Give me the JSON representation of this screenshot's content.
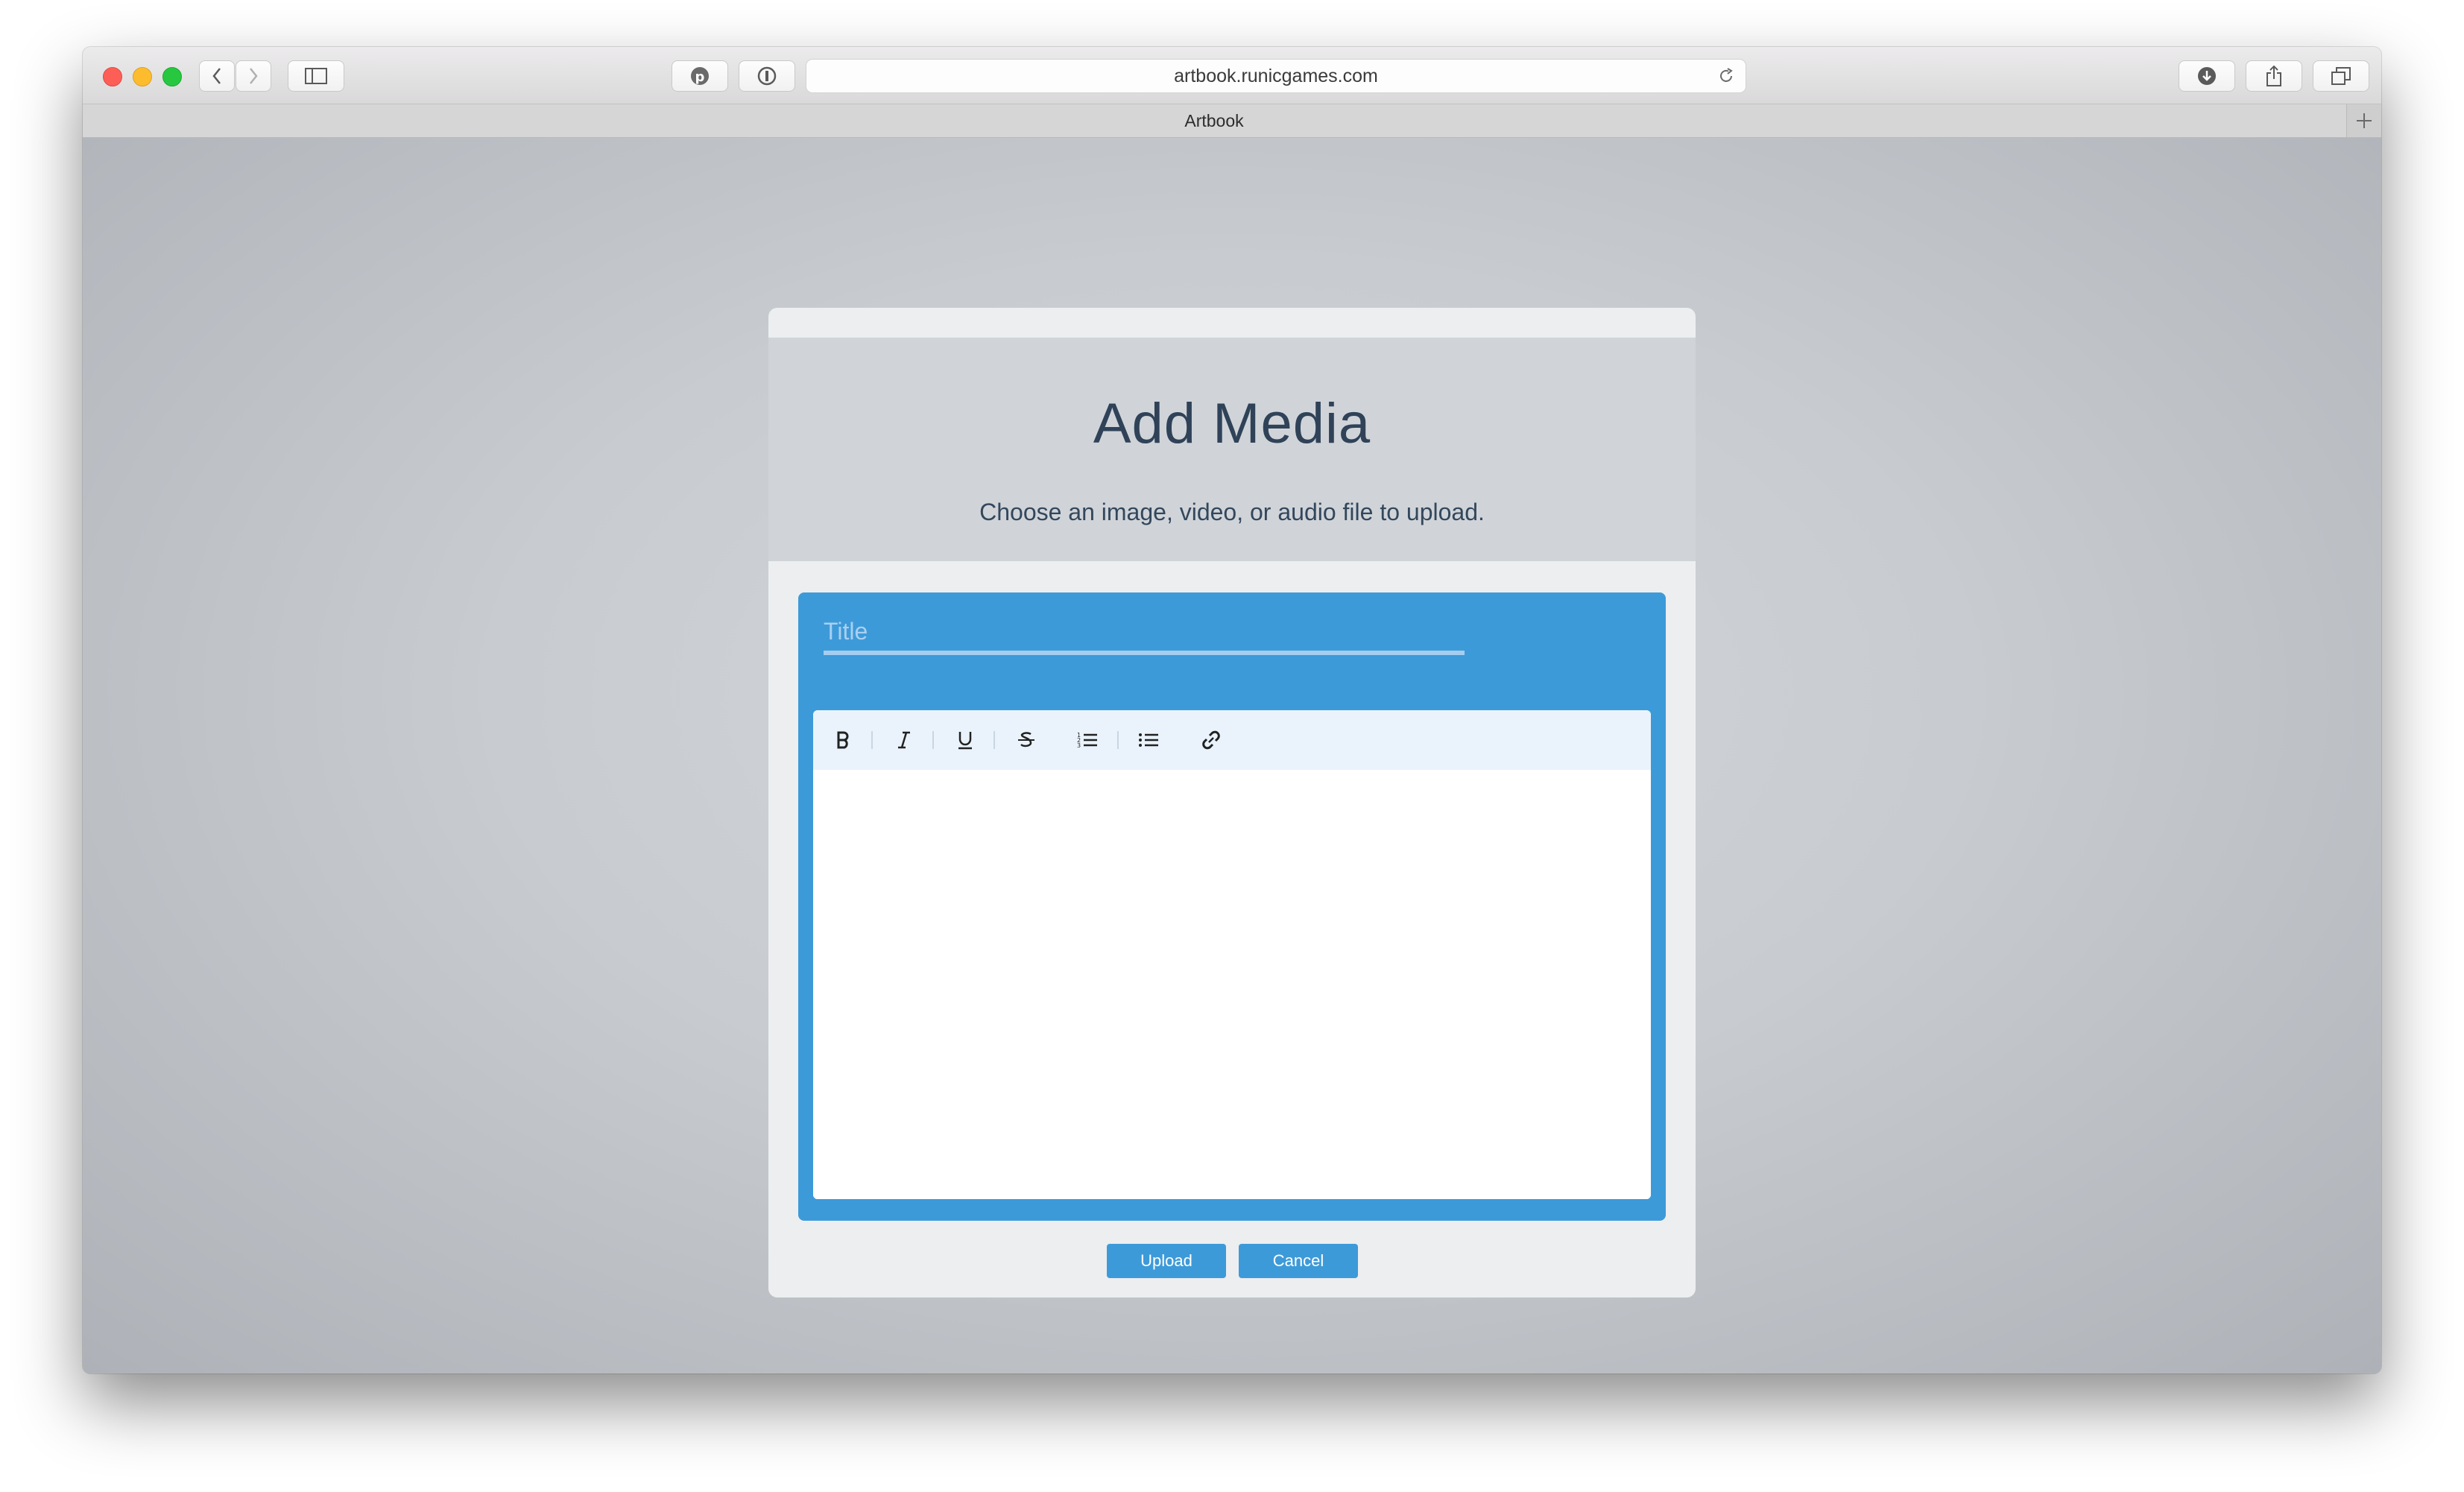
{
  "browser": {
    "url": "artbook.runicgames.com",
    "tab_title": "Artbook"
  },
  "modal": {
    "title": "Add Media",
    "subtitle": "Choose an image, video, or audio file to upload.",
    "title_field": {
      "placeholder": "Title",
      "value": ""
    },
    "editor_tools": [
      "bold",
      "italic",
      "underline",
      "strikethrough",
      "ordered-list",
      "unordered-list",
      "link"
    ],
    "buttons": {
      "upload": "Upload",
      "cancel": "Cancel"
    }
  },
  "colors": {
    "accent": "#3d9ad9",
    "header": "#d0d4d9",
    "title_text": "#2f4258"
  }
}
